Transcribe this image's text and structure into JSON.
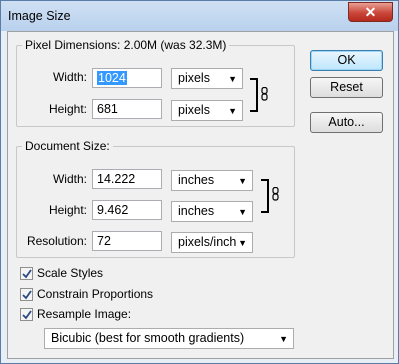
{
  "window": {
    "title": "Image Size",
    "close_glyph": "✕"
  },
  "pixel_dimensions": {
    "legend": "Pixel Dimensions:  2.00M (was 32.3M)",
    "width_label": "Width:",
    "width_value": "1024",
    "width_unit": "pixels",
    "height_label": "Height:",
    "height_value": "681",
    "height_unit": "pixels"
  },
  "document_size": {
    "legend": "Document Size:",
    "width_label": "Width:",
    "width_value": "14.222",
    "width_unit": "inches",
    "height_label": "Height:",
    "height_value": "9.462",
    "height_unit": "inches",
    "resolution_label": "Resolution:",
    "resolution_value": "72",
    "resolution_unit": "pixels/inch"
  },
  "buttons": {
    "ok": "OK",
    "reset": "Reset",
    "auto": "Auto..."
  },
  "options": {
    "scale_styles": {
      "label": "Scale Styles",
      "checked": true
    },
    "constrain_proportions": {
      "label": "Constrain Proportions",
      "checked": true
    },
    "resample_image": {
      "label": "Resample Image:",
      "checked": true
    },
    "resample_method": "Bicubic (best for smooth gradients)"
  },
  "icons": {
    "chain": "chain-link-icon",
    "dropdown": "chevron-down-icon",
    "check": "check-icon"
  },
  "colors": {
    "selection": "#3399ff",
    "titlebar": "#b9d1ee",
    "close_button": "#c9473a"
  }
}
